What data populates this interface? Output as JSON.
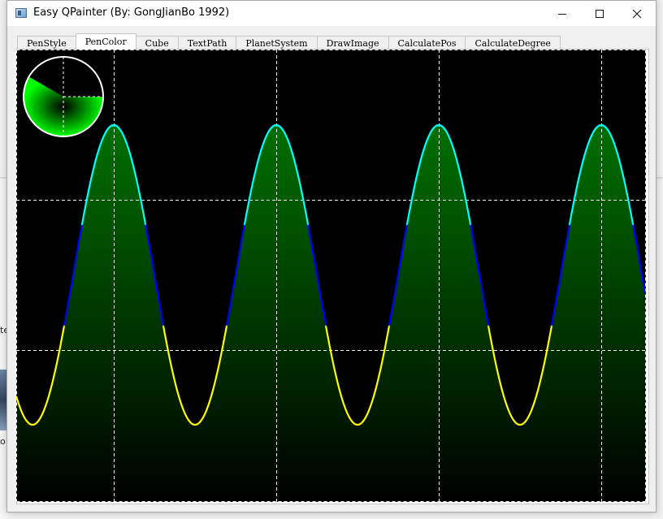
{
  "window": {
    "title": "Easy QPainter (By: GongJianBo 1992)",
    "controls": {
      "minimize": "—",
      "maximize": "☐",
      "close": "✕"
    }
  },
  "tabs": [
    {
      "label": "PenStyle",
      "active": false
    },
    {
      "label": "PenColor",
      "active": true
    },
    {
      "label": "Cube",
      "active": false
    },
    {
      "label": "TextPath",
      "active": false
    },
    {
      "label": "PlanetSystem",
      "active": false
    },
    {
      "label": "DrawImage",
      "active": false
    },
    {
      "label": "CalculatePos",
      "active": false
    },
    {
      "label": "CalculateDegree",
      "active": false
    }
  ],
  "background_fragments": {
    "text_a": "te",
    "text_b": "o"
  },
  "canvas": {
    "background_color": "#000000",
    "grid_color": "#ffffff",
    "grid": "dashed 4 columns by 3 rows",
    "wave": {
      "periods": 4,
      "top_color": "#00ffff",
      "middle_color": "#0000ff",
      "bottom_color": "#ffff00",
      "fill_top_color": "#007000",
      "fill_bottom_color": "#000000"
    },
    "gauge": {
      "ring_color": "#ffffff",
      "sector_color": "#00ff00",
      "sector_span_degrees": 210
    }
  }
}
